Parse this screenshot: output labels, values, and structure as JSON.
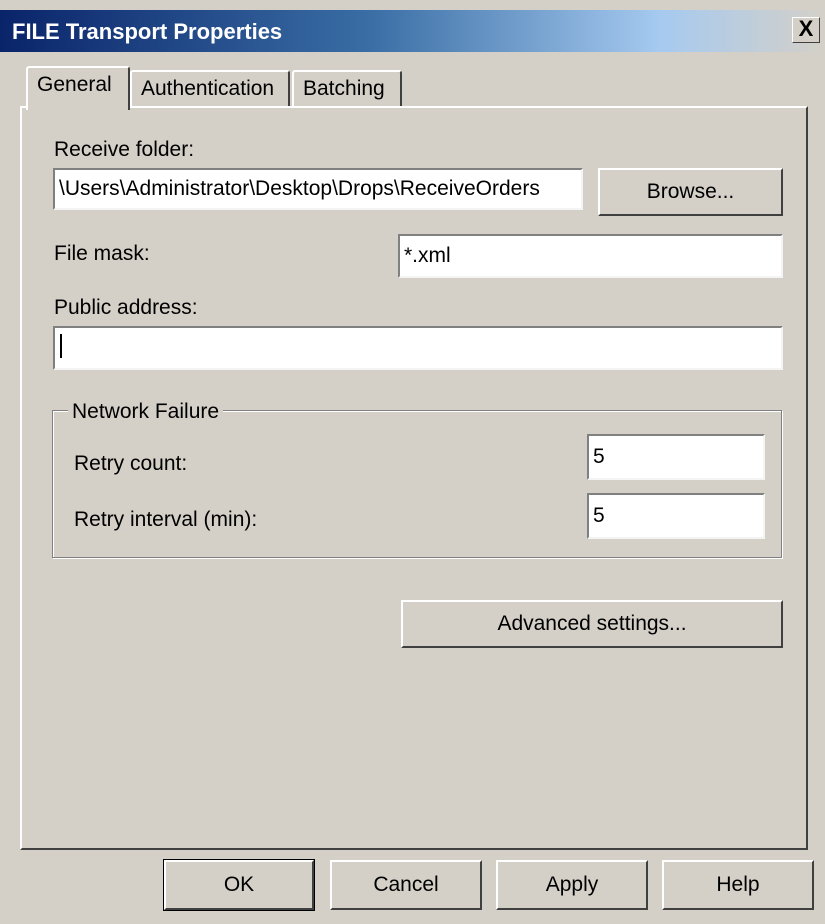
{
  "window": {
    "title": "FILE Transport Properties",
    "close_label": "X"
  },
  "tabs": [
    {
      "label": "General",
      "selected": true
    },
    {
      "label": "Authentication",
      "selected": false
    },
    {
      "label": "Batching",
      "selected": false
    }
  ],
  "general": {
    "receive_folder": {
      "label": "Receive folder:",
      "value": "\\Users\\Administrator\\Desktop\\Drops\\ReceiveOrders"
    },
    "browse_label": "Browse...",
    "file_mask": {
      "label": "File mask:",
      "value": "*.xml"
    },
    "public_address": {
      "label": "Public address:",
      "value": ""
    },
    "network_failure": {
      "title": "Network Failure",
      "retry_count": {
        "label": "Retry count:",
        "value": "5"
      },
      "retry_interval": {
        "label": "Retry interval (min):",
        "value": "5"
      }
    },
    "advanced_label": "Advanced settings..."
  },
  "footer": {
    "ok_label": "OK",
    "cancel_label": "Cancel",
    "apply_label": "Apply",
    "help_label": "Help"
  },
  "colors": {
    "dialog_bg": "#d4d0c8",
    "titlebar_start": "#0a246a",
    "titlebar_end": "#a6caf0"
  }
}
